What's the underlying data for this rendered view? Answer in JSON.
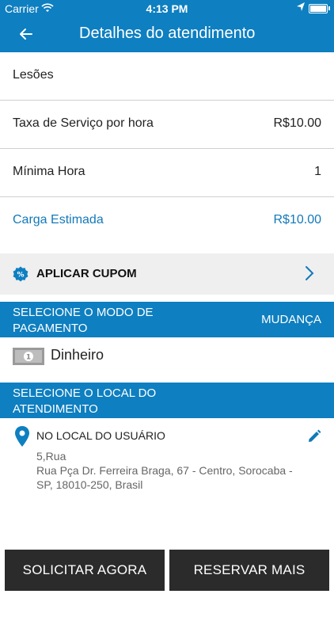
{
  "statusbar": {
    "carrier": "Carrier",
    "time": "4:13 PM"
  },
  "navbar": {
    "title": "Detalhes do atendimento"
  },
  "rows": [
    {
      "label": "Lesões",
      "value": ""
    },
    {
      "label": "Taxa de Serviço por hora",
      "value": "R$10.00"
    },
    {
      "label": "Mínima Hora",
      "value": "1"
    },
    {
      "label": "Carga Estimada",
      "value": "R$10.00"
    }
  ],
  "coupon": {
    "label": "APLICAR CUPOM"
  },
  "payment": {
    "title": "SELECIONE O MODO DE PAGAMENTO",
    "change": "MUDANÇA",
    "method": "Dinheiro"
  },
  "location": {
    "title": "SELECIONE O LOCAL DO ATENDIMENTO",
    "place": "NO LOCAL DO USUÁRIO",
    "line1": "5,Rua",
    "line2": "Rua Pça Dr. Ferreira Braga,  67 - Centro,  Sorocaba -",
    "line3": "SP,  18010-250,  Brasil"
  },
  "footer": {
    "request_now": "SOLICITAR AGORA",
    "book_later": "RESERVAR MAIS TARDE"
  },
  "colors": {
    "primary": "#0e7fc0",
    "accent_text": "#1279b9",
    "button_dark": "#2b2b2b"
  },
  "icons": [
    "wifi-icon",
    "location-arrow-icon",
    "battery-icon",
    "back-arrow-icon",
    "percent-icon",
    "chevron-right-icon",
    "cash-icon",
    "location-pin-icon",
    "edit-pencil-icon"
  ]
}
